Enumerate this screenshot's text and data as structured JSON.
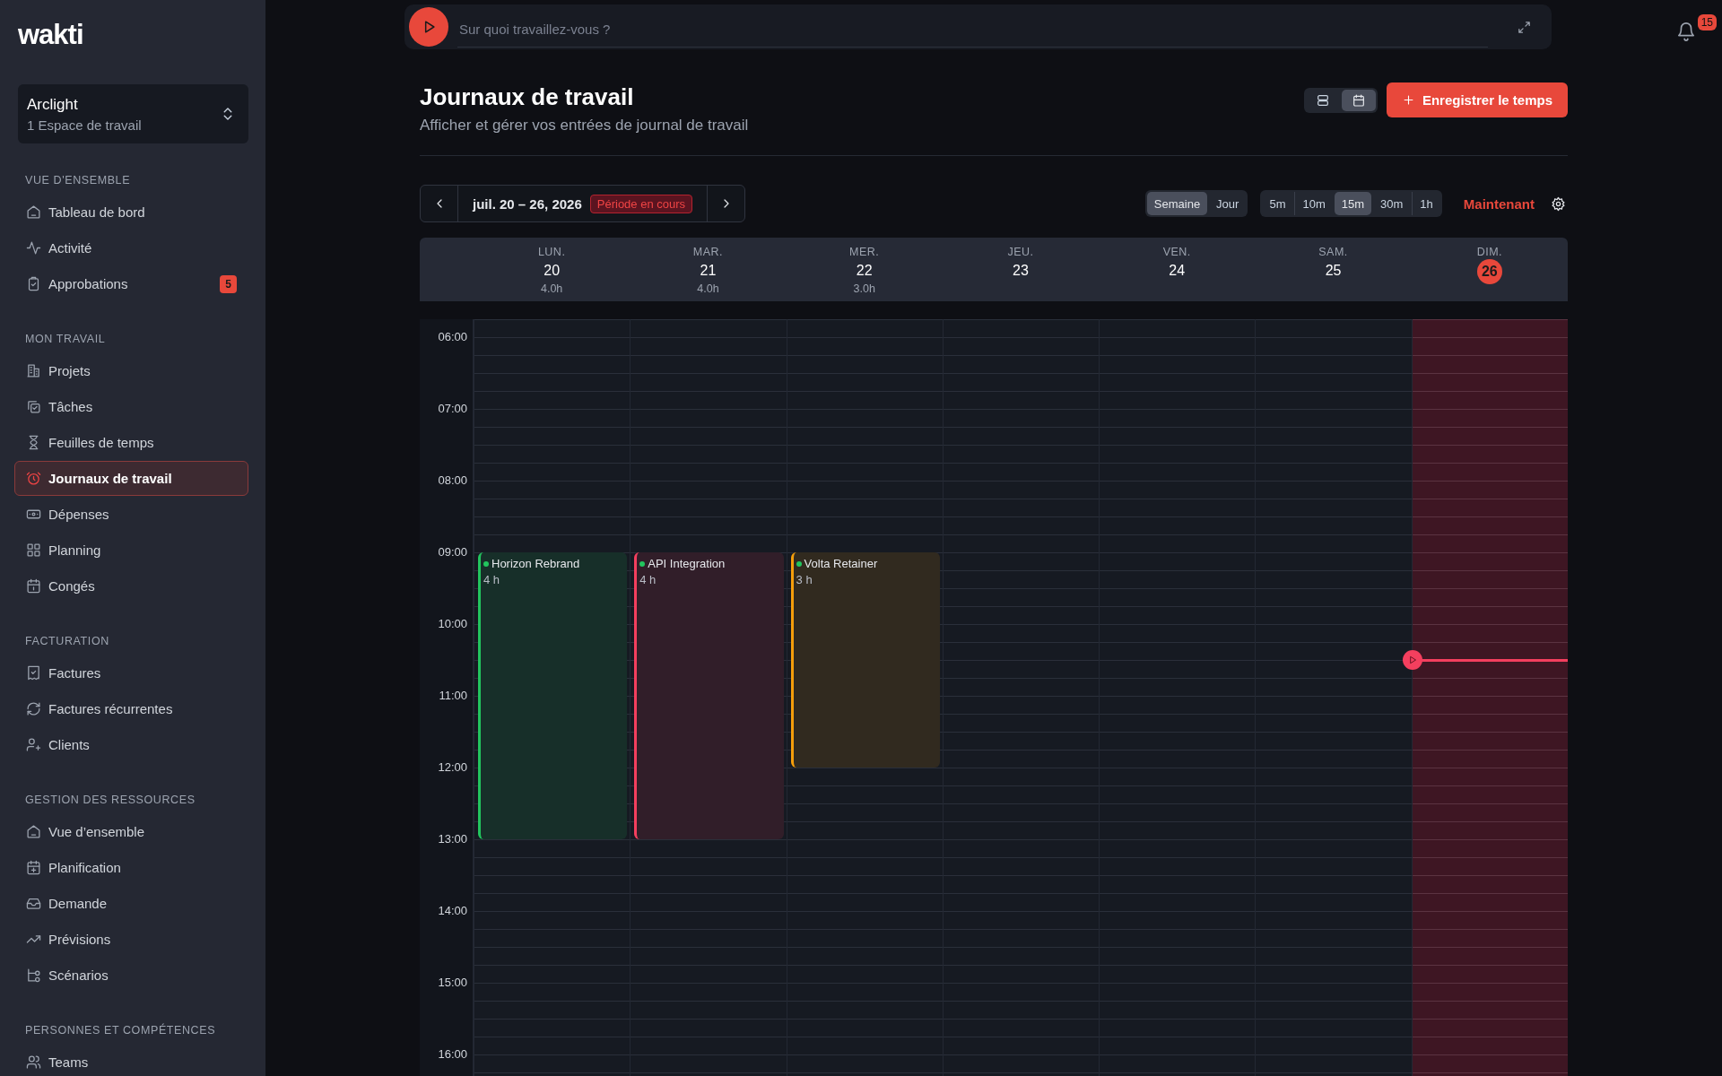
{
  "logo": {
    "text": "wakti"
  },
  "notifications": {
    "count": "15"
  },
  "workspace": {
    "name": "Arclight",
    "subtitle": "1 Espace de travail"
  },
  "sidebar": {
    "sections": [
      {
        "title": "VUE D'ENSEMBLE",
        "items": [
          {
            "label": "Tableau de bord",
            "selected": false
          },
          {
            "label": "Activité",
            "selected": false
          },
          {
            "label": "Approbations",
            "selected": false,
            "badge": "5"
          }
        ]
      },
      {
        "title": "MON TRAVAIL",
        "items": [
          {
            "label": "Projets",
            "selected": false
          },
          {
            "label": "Tâches",
            "selected": false
          },
          {
            "label": "Feuilles de temps",
            "selected": false
          },
          {
            "label": "Journaux de travail",
            "selected": true
          },
          {
            "label": "Dépenses",
            "selected": false
          },
          {
            "label": "Planning",
            "selected": false
          },
          {
            "label": "Congés",
            "selected": false
          }
        ]
      },
      {
        "title": "FACTURATION",
        "items": [
          {
            "label": "Factures",
            "selected": false
          },
          {
            "label": "Factures récurrentes",
            "selected": false
          },
          {
            "label": "Clients",
            "selected": false
          }
        ]
      },
      {
        "title": "GESTION DES RESSOURCES",
        "items": [
          {
            "label": "Vue d’ensemble",
            "selected": false
          },
          {
            "label": "Planification",
            "selected": false
          },
          {
            "label": "Demande",
            "selected": false
          },
          {
            "label": "Prévisions",
            "selected": false
          },
          {
            "label": "Scénarios",
            "selected": false
          }
        ]
      },
      {
        "title": "PERSONNES ET COMPÉTENCES",
        "items": [
          {
            "label": "Teams",
            "selected": false
          }
        ]
      }
    ]
  },
  "timer": {
    "placeholder": "Sur quoi travaillez-vous ?"
  },
  "header": {
    "title": "Journaux de travail",
    "subtitle": "Afficher et gérer vos entrées de journal de travail",
    "view_modes": [
      {
        "selected": false
      },
      {
        "selected": true
      }
    ],
    "record_button": "Enregistrer le temps"
  },
  "toolbar": {
    "period": "juil. 20 – 26, 2026",
    "period_badge": "Période en cours",
    "ranges": [
      {
        "label": "Semaine",
        "selected": true
      },
      {
        "label": "Jour",
        "selected": false
      }
    ],
    "intervals": [
      {
        "label": "5m",
        "selected": false
      },
      {
        "label": "10m",
        "selected": false
      },
      {
        "label": "15m",
        "selected": true
      },
      {
        "label": "30m",
        "selected": false
      },
      {
        "label": "1h",
        "selected": false
      }
    ],
    "now_button": "Maintenant"
  },
  "calendar": {
    "days": [
      {
        "weekday": "LUN.",
        "date": "20",
        "total": "4.0h",
        "today": false
      },
      {
        "weekday": "MAR.",
        "date": "21",
        "total": "4.0h",
        "today": false
      },
      {
        "weekday": "MER.",
        "date": "22",
        "total": "3.0h",
        "today": false
      },
      {
        "weekday": "JEU.",
        "date": "23",
        "today": false
      },
      {
        "weekday": "VEN.",
        "date": "24",
        "today": false
      },
      {
        "weekday": "SAM.",
        "date": "25",
        "today": false
      },
      {
        "weekday": "DIM.",
        "date": "26",
        "today": true
      }
    ],
    "hours": [
      {
        "label": "06:00"
      },
      {
        "label": "07:00"
      },
      {
        "label": "08:00"
      },
      {
        "label": "09:00",
        "cells": [
          {
            "project": "Horizon Rebrand",
            "duration": "4 h",
            "color": "#22c55e"
          },
          {
            "project": "API Integration",
            "duration": "4 h",
            "color": "#f43f5e"
          },
          {
            "project": "Volta Retainer",
            "duration": "3 h",
            "color": "#f59e0b"
          }
        ]
      },
      {
        "label": "10:00",
        "now_line": true
      },
      {
        "label": "11:00"
      },
      {
        "label": "12:00"
      },
      {
        "label": "13:00"
      },
      {
        "label": "14:00"
      },
      {
        "label": "15:00"
      },
      {
        "label": "16:00"
      }
    ]
  }
}
